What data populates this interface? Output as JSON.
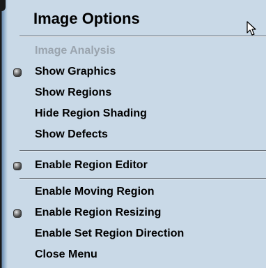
{
  "menu": {
    "title": "Image Options",
    "items": [
      {
        "label": "Image Analysis",
        "enabled": false,
        "checked": false
      },
      {
        "label": "Show Graphics",
        "enabled": true,
        "checked": true
      },
      {
        "label": "Show Regions",
        "enabled": true,
        "checked": false
      },
      {
        "label": "Hide Region Shading",
        "enabled": true,
        "checked": false
      },
      {
        "label": "Show Defects",
        "enabled": true,
        "checked": false
      },
      {
        "label": "Enable Region Editor",
        "enabled": true,
        "checked": true
      },
      {
        "label": "Enable Moving Region",
        "enabled": true,
        "checked": false
      },
      {
        "label": "Enable Region Resizing",
        "enabled": true,
        "checked": true
      },
      {
        "label": "Enable Set Region Direction",
        "enabled": true,
        "checked": false
      },
      {
        "label": "Close Menu",
        "enabled": true,
        "checked": false
      }
    ]
  },
  "icons": {
    "cursor": "arrow-cursor-icon",
    "check": "check-bullet-icon"
  },
  "colors": {
    "menu_background": "#c9d9e7",
    "disabled_text": "#9aa4ae",
    "text": "#000000"
  }
}
